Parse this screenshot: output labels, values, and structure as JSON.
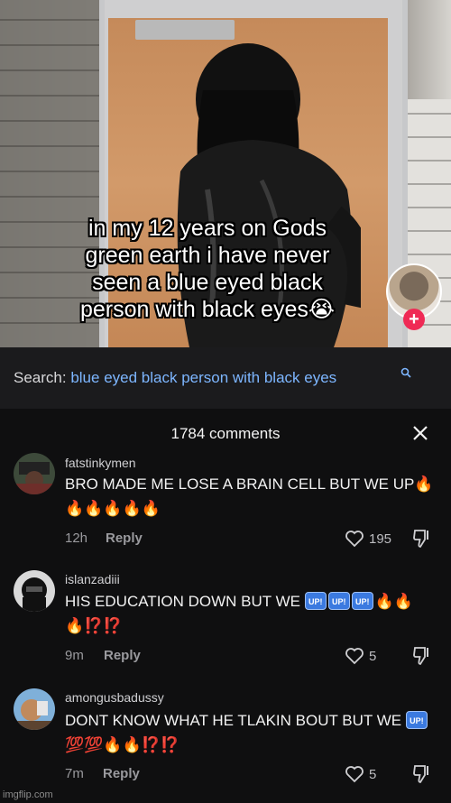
{
  "video": {
    "caption_lines": [
      "in my 12 years on Gods",
      "green earth i have never",
      "seen a blue eyed black",
      "person with black eyes😭"
    ],
    "follow_symbol": "+"
  },
  "search": {
    "label": "Search:",
    "query": "blue eyed black person with black eyes",
    "icon": "search-icon"
  },
  "comments_panel": {
    "title": "1784 comments",
    "close_icon": "close-icon",
    "reply_label": "Reply",
    "comments": [
      {
        "username": "fatstinkymen",
        "text": "BRO MADE ME LOSE A BRAIN CELL BUT WE UP🔥🔥🔥🔥🔥🔥",
        "time": "12h",
        "likes": "195"
      },
      {
        "username": "islanzadiii",
        "text_before": "HIS EDUCATION DOWN BUT WE ",
        "badges": [
          "UP!",
          "UP!",
          "UP!"
        ],
        "text_after": "🔥🔥🔥⁉️⁉️",
        "time": "9m",
        "likes": "5"
      },
      {
        "username": "amongusbadussy",
        "text_before": "DONT KNOW WHAT HE TLAKIN BOUT BUT WE ",
        "badges": [
          "UP!"
        ],
        "text_after": " 💯💯🔥🔥⁉️⁉️",
        "time": "7m",
        "likes": "5"
      }
    ]
  },
  "watermark": "imgflip.com",
  "colors": {
    "accent_pink": "#ef2a55",
    "search_query": "#7db6ff",
    "background": "#0f0f10"
  }
}
